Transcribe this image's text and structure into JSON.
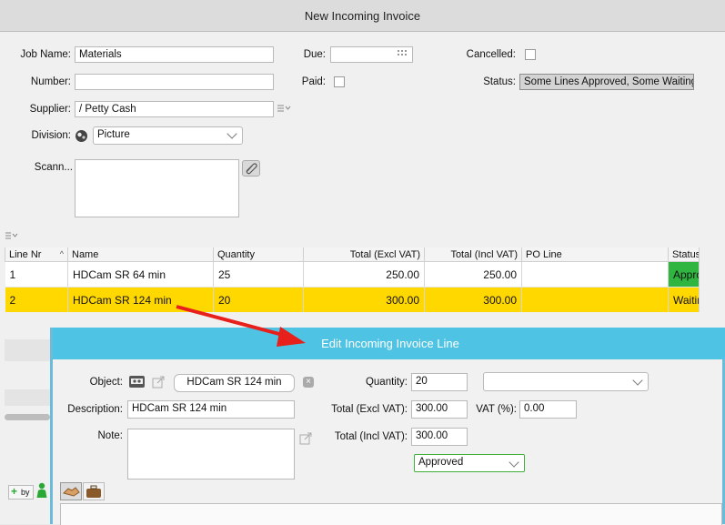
{
  "window": {
    "title": "New Incoming Invoice"
  },
  "form": {
    "job_name_label": "Job Name:",
    "job_name_value": "Materials",
    "number_label": "Number:",
    "number_value": "",
    "supplier_label": "Supplier:",
    "supplier_value": "/ Petty Cash",
    "division_label": "Division:",
    "division_value": "Picture",
    "scan_label": "Scann...",
    "due_label": "Due:",
    "due_value": "",
    "paid_label": "Paid:",
    "cancelled_label": "Cancelled:",
    "status_label": "Status:",
    "status_value": "Some Lines Approved, Some Waiting"
  },
  "grid": {
    "columns": [
      "Line Nr",
      "Name",
      "Quantity",
      "Total (Excl VAT)",
      "Total (Incl VAT)",
      "PO Line",
      "Status"
    ],
    "rows": [
      {
        "line": "1",
        "name": "HDCam SR 64 min",
        "qty": "25",
        "excl": "250.00",
        "incl": "250.00",
        "po": "",
        "status": "Appro"
      },
      {
        "line": "2",
        "name": "HDCam SR 124 min",
        "qty": "20",
        "excl": "300.00",
        "incl": "300.00",
        "po": "",
        "status": "Waitin"
      }
    ]
  },
  "dialog": {
    "title": "Edit Incoming Invoice Line",
    "object_label": "Object:",
    "object_value": "HDCam SR 124 min",
    "description_label": "Description:",
    "description_value": "HDCam SR 124 min",
    "note_label": "Note:",
    "quantity_label": "Quantity:",
    "quantity_value": "20",
    "excl_label": "Total (Excl VAT):",
    "excl_value": "300.00",
    "vat_label": "VAT (%):",
    "vat_value": "0.00",
    "incl_label": "Total (Incl VAT):",
    "incl_value": "300.00",
    "approval_value": "Approved"
  },
  "footer": {
    "by_label": "by"
  },
  "colors": {
    "highlight_row": "#ffd800",
    "approved_status": "#30b540",
    "dialog_title": "#4fc3e3",
    "arrow": "#e8201b"
  }
}
